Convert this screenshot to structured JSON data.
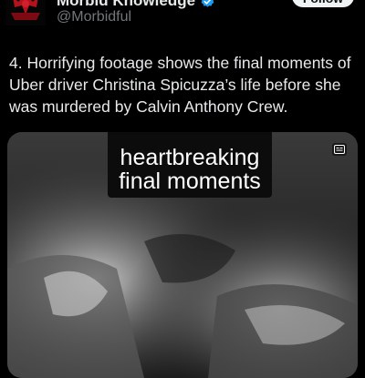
{
  "post": {
    "display_name": "Morbid Knowledge",
    "handle": "@Morbidful",
    "follow_label": "Follow",
    "text": "4. Horrifying footage shows the final moments of Uber driver Christina Spicuzza’s life before she was murdered by Calvin Anthony Crew."
  },
  "media": {
    "caption_line_1": "heartbreaking",
    "caption_line_2": "final moments",
    "badge_icon": "captions-icon"
  },
  "colors": {
    "background": "#000000",
    "text": "#e7e9ea",
    "secondary_text": "#71767b",
    "verified": "#1d9bf0",
    "follow_bg": "#eff3f4"
  }
}
